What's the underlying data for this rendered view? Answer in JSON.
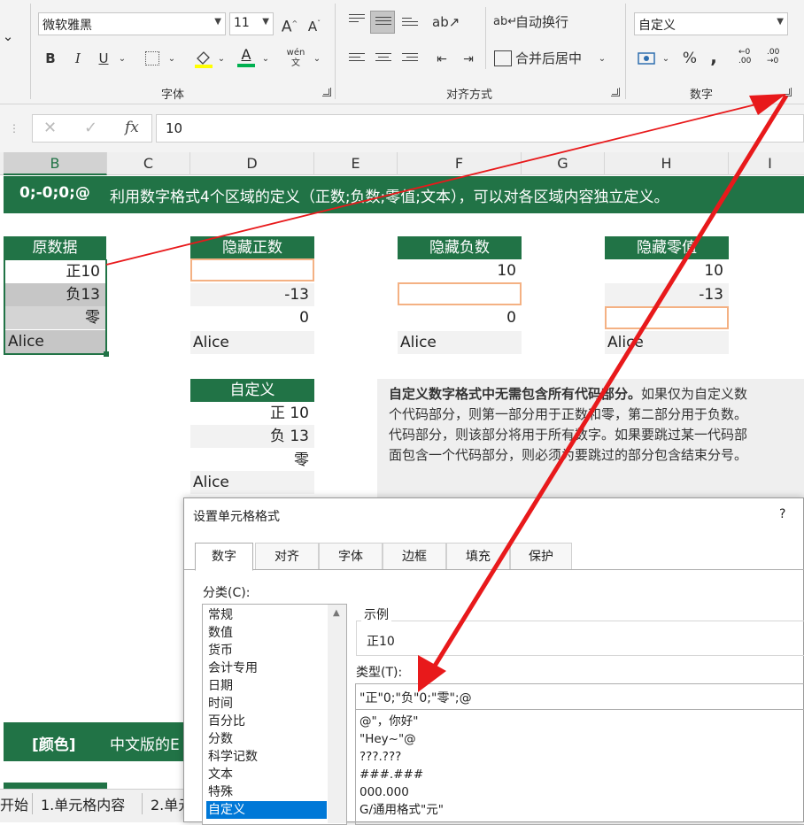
{
  "ribbon": {
    "font_name": "微软雅黑",
    "font_size": "11",
    "grow_font_label": "A",
    "shrink_font_label": "A",
    "bold": "B",
    "italic": "I",
    "underline": "U",
    "font_color_letter": "A",
    "phonetic_label": "wén 文",
    "font_group_label": "字体",
    "wrap_text_label": "自动换行",
    "merge_center_label": "合并后居中",
    "alignment_group_label": "对齐方式",
    "number_format": "自定义",
    "percent": "%",
    "comma": ",",
    "inc_decimal": ".00",
    "dec_decimal": ".00",
    "number_group_label": "数字",
    "collapse_chevron": "⌄",
    "accent_green": "#217346",
    "highlight_orange": "#f4b183",
    "arrow_red": "#e8191b"
  },
  "formula_bar": {
    "cancel": "✕",
    "enter": "✓",
    "fx": "fx",
    "value": "10"
  },
  "columns": [
    "B",
    "C",
    "D",
    "E",
    "F",
    "G",
    "H",
    "I"
  ],
  "banner_top": {
    "code": "0;-0;0;@",
    "text": "利用数字格式4个区域的定义（正数;负数;零值;文本），可以对各区域内容独立定义。"
  },
  "tables": {
    "original": {
      "header": "原数据",
      "rows": [
        "正10",
        "负13",
        "零",
        "Alice"
      ]
    },
    "hide_positive": {
      "header": "隐藏正数",
      "rows": [
        "",
        "-13",
        "0",
        "Alice"
      ]
    },
    "hide_negative": {
      "header": "隐藏负数",
      "rows": [
        "10",
        "",
        "0",
        "Alice"
      ]
    },
    "hide_zero": {
      "header": "隐藏零值",
      "rows": [
        "10",
        "-13",
        "",
        "Alice"
      ]
    },
    "custom": {
      "header": "自定义",
      "rows": [
        "正 10",
        "负 13",
        "零",
        "Alice"
      ]
    }
  },
  "note": {
    "bold": "自定义数字格式中无需包含所有代码部分。",
    "line1": "如果仅为自定义数",
    "line2": "个代码部分，则第一部分用于正数和零，第二部分用于负数。",
    "line3": "代码部分，则该部分将用于所有数字。如果要跳过某一代码部",
    "line4": "面包含一个代码部分，则必须为要跳过的部分包含结束分号。"
  },
  "banner_bottom": {
    "tag": "[颜色]",
    "text": "中文版的E"
  },
  "sheet_tabs": [
    "开始",
    "1.单元格内容",
    "2.单元"
  ],
  "dialog": {
    "title": "设置单元格格式",
    "help": "?",
    "tabs": [
      "数字",
      "对齐",
      "字体",
      "边框",
      "填充",
      "保护"
    ],
    "category_label": "分类(C):",
    "categories": [
      "常规",
      "数值",
      "货币",
      "会计专用",
      "日期",
      "时间",
      "百分比",
      "分数",
      "科学记数",
      "文本",
      "特殊",
      "自定义"
    ],
    "sample_label": "示例",
    "sample_value": "正10",
    "type_label": "类型(T):",
    "type_value": "\"正\"0;\"负\"0;\"零\";@",
    "formats": [
      "@\"，你好\"",
      "\"Hey~\"@",
      "???.???",
      "###.###",
      "000.000",
      "G/通用格式\"元\""
    ]
  }
}
